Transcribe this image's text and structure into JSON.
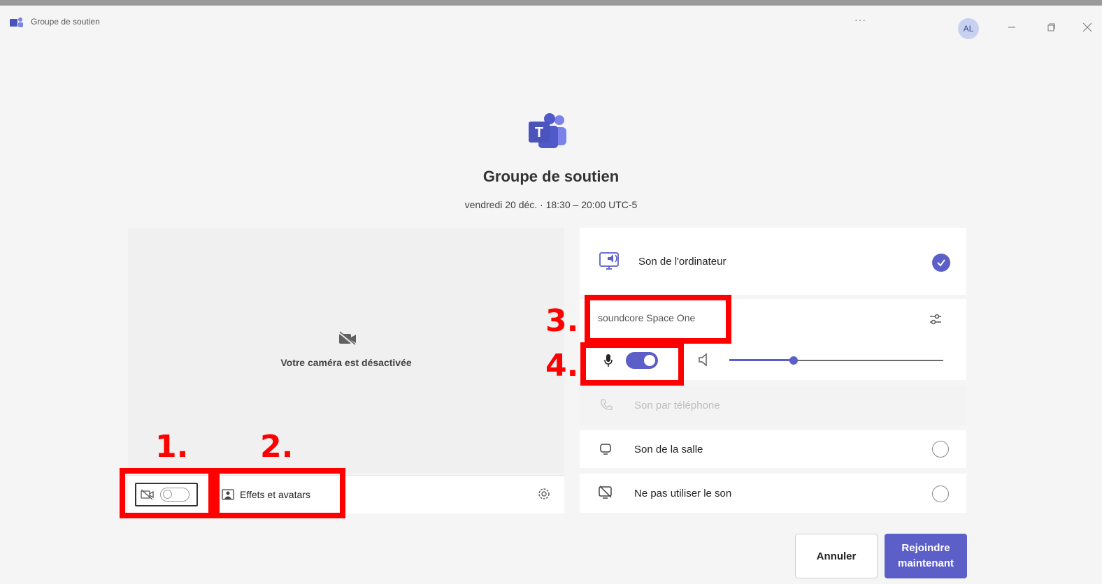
{
  "window": {
    "title": "Groupe de soutien",
    "more_label": "···",
    "avatar_initials": "AL"
  },
  "meeting": {
    "title": "Groupe de soutien",
    "time": "vendredi 20 déc. · 18:30 – 20:00 UTC-5"
  },
  "video": {
    "camera_off_text": "Votre caméra est désactivée",
    "camera_toggle_on": false,
    "effects_label": "Effets et avatars"
  },
  "audio": {
    "computer_label": "Son de l'ordinateur",
    "computer_selected": true,
    "device_name": "soundcore Space One",
    "mic_on": true,
    "volume_fraction": 0.3,
    "phone_label": "Son par téléphone",
    "room_label": "Son de la salle",
    "none_label": "Ne pas utiliser le son"
  },
  "annotations": {
    "one": "1.",
    "two": "2.",
    "three": "3.",
    "four": "4."
  },
  "buttons": {
    "cancel": "Annuler",
    "join": "Rejoindre maintenant"
  },
  "colors": {
    "accent": "#5b5fc7",
    "annotation": "#ff0000"
  }
}
